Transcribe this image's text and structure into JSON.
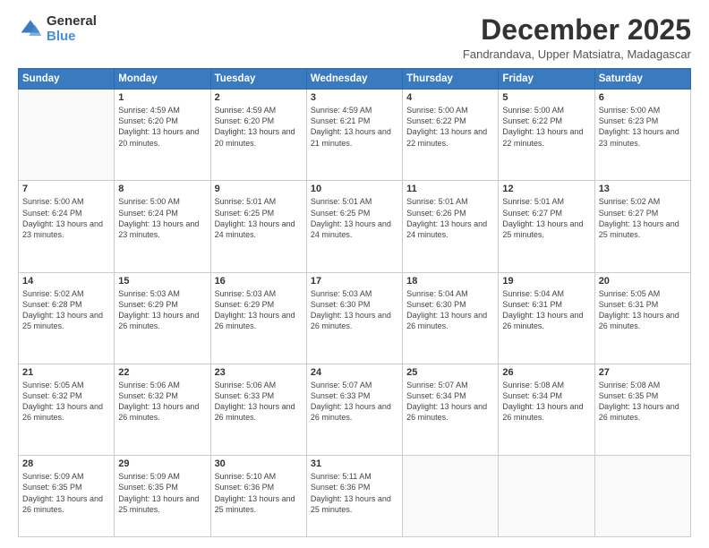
{
  "logo": {
    "general": "General",
    "blue": "Blue"
  },
  "header": {
    "month": "December 2025",
    "location": "Fandrandava, Upper Matsiatra, Madagascar"
  },
  "days_of_week": [
    "Sunday",
    "Monday",
    "Tuesday",
    "Wednesday",
    "Thursday",
    "Friday",
    "Saturday"
  ],
  "weeks": [
    [
      {
        "day": "",
        "sunrise": "",
        "sunset": "",
        "daylight": ""
      },
      {
        "day": "1",
        "sunrise": "Sunrise: 4:59 AM",
        "sunset": "Sunset: 6:20 PM",
        "daylight": "Daylight: 13 hours and 20 minutes."
      },
      {
        "day": "2",
        "sunrise": "Sunrise: 4:59 AM",
        "sunset": "Sunset: 6:20 PM",
        "daylight": "Daylight: 13 hours and 20 minutes."
      },
      {
        "day": "3",
        "sunrise": "Sunrise: 4:59 AM",
        "sunset": "Sunset: 6:21 PM",
        "daylight": "Daylight: 13 hours and 21 minutes."
      },
      {
        "day": "4",
        "sunrise": "Sunrise: 5:00 AM",
        "sunset": "Sunset: 6:22 PM",
        "daylight": "Daylight: 13 hours and 22 minutes."
      },
      {
        "day": "5",
        "sunrise": "Sunrise: 5:00 AM",
        "sunset": "Sunset: 6:22 PM",
        "daylight": "Daylight: 13 hours and 22 minutes."
      },
      {
        "day": "6",
        "sunrise": "Sunrise: 5:00 AM",
        "sunset": "Sunset: 6:23 PM",
        "daylight": "Daylight: 13 hours and 23 minutes."
      }
    ],
    [
      {
        "day": "7",
        "sunrise": "Sunrise: 5:00 AM",
        "sunset": "Sunset: 6:24 PM",
        "daylight": "Daylight: 13 hours and 23 minutes."
      },
      {
        "day": "8",
        "sunrise": "Sunrise: 5:00 AM",
        "sunset": "Sunset: 6:24 PM",
        "daylight": "Daylight: 13 hours and 23 minutes."
      },
      {
        "day": "9",
        "sunrise": "Sunrise: 5:01 AM",
        "sunset": "Sunset: 6:25 PM",
        "daylight": "Daylight: 13 hours and 24 minutes."
      },
      {
        "day": "10",
        "sunrise": "Sunrise: 5:01 AM",
        "sunset": "Sunset: 6:25 PM",
        "daylight": "Daylight: 13 hours and 24 minutes."
      },
      {
        "day": "11",
        "sunrise": "Sunrise: 5:01 AM",
        "sunset": "Sunset: 6:26 PM",
        "daylight": "Daylight: 13 hours and 24 minutes."
      },
      {
        "day": "12",
        "sunrise": "Sunrise: 5:01 AM",
        "sunset": "Sunset: 6:27 PM",
        "daylight": "Daylight: 13 hours and 25 minutes."
      },
      {
        "day": "13",
        "sunrise": "Sunrise: 5:02 AM",
        "sunset": "Sunset: 6:27 PM",
        "daylight": "Daylight: 13 hours and 25 minutes."
      }
    ],
    [
      {
        "day": "14",
        "sunrise": "Sunrise: 5:02 AM",
        "sunset": "Sunset: 6:28 PM",
        "daylight": "Daylight: 13 hours and 25 minutes."
      },
      {
        "day": "15",
        "sunrise": "Sunrise: 5:03 AM",
        "sunset": "Sunset: 6:29 PM",
        "daylight": "Daylight: 13 hours and 26 minutes."
      },
      {
        "day": "16",
        "sunrise": "Sunrise: 5:03 AM",
        "sunset": "Sunset: 6:29 PM",
        "daylight": "Daylight: 13 hours and 26 minutes."
      },
      {
        "day": "17",
        "sunrise": "Sunrise: 5:03 AM",
        "sunset": "Sunset: 6:30 PM",
        "daylight": "Daylight: 13 hours and 26 minutes."
      },
      {
        "day": "18",
        "sunrise": "Sunrise: 5:04 AM",
        "sunset": "Sunset: 6:30 PM",
        "daylight": "Daylight: 13 hours and 26 minutes."
      },
      {
        "day": "19",
        "sunrise": "Sunrise: 5:04 AM",
        "sunset": "Sunset: 6:31 PM",
        "daylight": "Daylight: 13 hours and 26 minutes."
      },
      {
        "day": "20",
        "sunrise": "Sunrise: 5:05 AM",
        "sunset": "Sunset: 6:31 PM",
        "daylight": "Daylight: 13 hours and 26 minutes."
      }
    ],
    [
      {
        "day": "21",
        "sunrise": "Sunrise: 5:05 AM",
        "sunset": "Sunset: 6:32 PM",
        "daylight": "Daylight: 13 hours and 26 minutes."
      },
      {
        "day": "22",
        "sunrise": "Sunrise: 5:06 AM",
        "sunset": "Sunset: 6:32 PM",
        "daylight": "Daylight: 13 hours and 26 minutes."
      },
      {
        "day": "23",
        "sunrise": "Sunrise: 5:06 AM",
        "sunset": "Sunset: 6:33 PM",
        "daylight": "Daylight: 13 hours and 26 minutes."
      },
      {
        "day": "24",
        "sunrise": "Sunrise: 5:07 AM",
        "sunset": "Sunset: 6:33 PM",
        "daylight": "Daylight: 13 hours and 26 minutes."
      },
      {
        "day": "25",
        "sunrise": "Sunrise: 5:07 AM",
        "sunset": "Sunset: 6:34 PM",
        "daylight": "Daylight: 13 hours and 26 minutes."
      },
      {
        "day": "26",
        "sunrise": "Sunrise: 5:08 AM",
        "sunset": "Sunset: 6:34 PM",
        "daylight": "Daylight: 13 hours and 26 minutes."
      },
      {
        "day": "27",
        "sunrise": "Sunrise: 5:08 AM",
        "sunset": "Sunset: 6:35 PM",
        "daylight": "Daylight: 13 hours and 26 minutes."
      }
    ],
    [
      {
        "day": "28",
        "sunrise": "Sunrise: 5:09 AM",
        "sunset": "Sunset: 6:35 PM",
        "daylight": "Daylight: 13 hours and 26 minutes."
      },
      {
        "day": "29",
        "sunrise": "Sunrise: 5:09 AM",
        "sunset": "Sunset: 6:35 PM",
        "daylight": "Daylight: 13 hours and 25 minutes."
      },
      {
        "day": "30",
        "sunrise": "Sunrise: 5:10 AM",
        "sunset": "Sunset: 6:36 PM",
        "daylight": "Daylight: 13 hours and 25 minutes."
      },
      {
        "day": "31",
        "sunrise": "Sunrise: 5:11 AM",
        "sunset": "Sunset: 6:36 PM",
        "daylight": "Daylight: 13 hours and 25 minutes."
      },
      {
        "day": "",
        "sunrise": "",
        "sunset": "",
        "daylight": ""
      },
      {
        "day": "",
        "sunrise": "",
        "sunset": "",
        "daylight": ""
      },
      {
        "day": "",
        "sunrise": "",
        "sunset": "",
        "daylight": ""
      }
    ]
  ]
}
